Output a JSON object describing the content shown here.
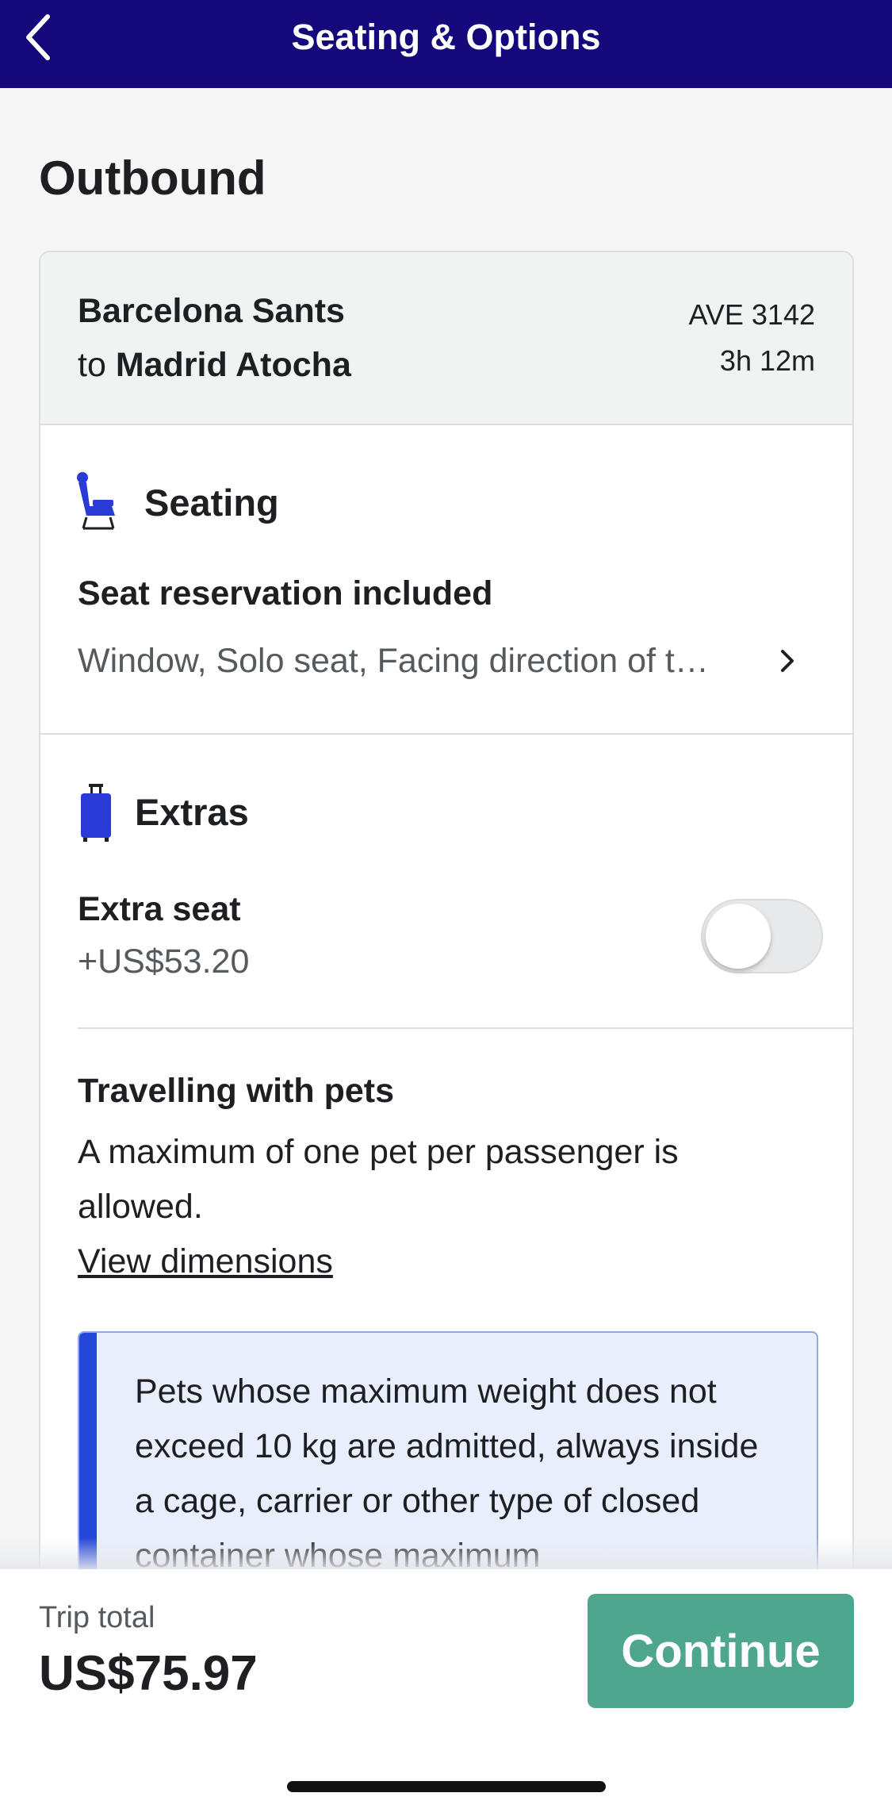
{
  "header": {
    "title": "Seating & Options",
    "back_icon": "chevron-left-icon",
    "background": "#14087a"
  },
  "outbound": {
    "title": "Outbound",
    "route": {
      "from": "Barcelona Sants",
      "to_prefix": "to",
      "to": "Madrid Atocha",
      "train": "AVE 3142",
      "duration": "3h 12m"
    },
    "seating": {
      "icon": "seat-icon",
      "heading": "Seating",
      "reservation": "Seat reservation included",
      "detail": "Window, Solo seat, Facing direction of t…"
    },
    "extras": {
      "icon": "suitcase-icon",
      "heading": "Extras",
      "extra_seat": {
        "label": "Extra seat",
        "price": "+US$53.20",
        "enabled": false
      },
      "pets": {
        "title": "Travelling with pets",
        "text": "A maximum of one pet per passenger is allowed.",
        "link": "View dimensions",
        "notice": "Pets whose maximum weight does not exceed 10 kg are admitted, always inside a cage, carrier or other type of closed container whose maximum"
      }
    }
  },
  "footer": {
    "total_label": "Trip total",
    "total": "US$75.97",
    "continue_label": "Continue",
    "button_color": "#4ea68f"
  },
  "colors": {
    "brand": "#14087a",
    "accent_blue": "#2347d8",
    "notice_bg": "#e8eefc"
  }
}
